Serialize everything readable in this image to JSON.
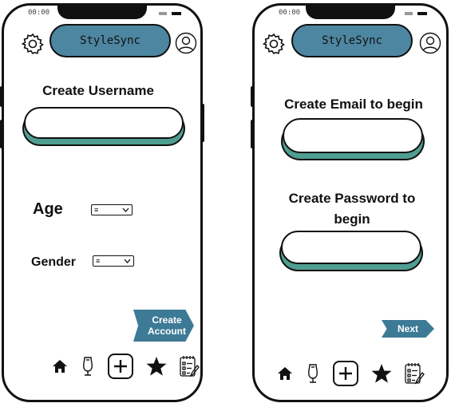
{
  "status_bar": {
    "time": "00:00"
  },
  "app": {
    "brand": "StyleSync"
  },
  "screen_one": {
    "heading": "Create Username",
    "username_value": "",
    "age_label": "Age",
    "gender_label": "Gender",
    "create_account_label": "Create Account"
  },
  "screen_two": {
    "email_heading": "Create Email to begin",
    "email_value": "",
    "password_heading": "Create Password to begin",
    "password_value": "",
    "next_label": "Next"
  },
  "nav": {
    "icons": [
      "home-icon",
      "mannequin-icon",
      "add-icon",
      "star-icon",
      "notepad-icon"
    ]
  },
  "colors": {
    "brand_blue": "#4d86a0",
    "button_blue": "#3d7a96",
    "field_accent": "#4f9e92"
  }
}
